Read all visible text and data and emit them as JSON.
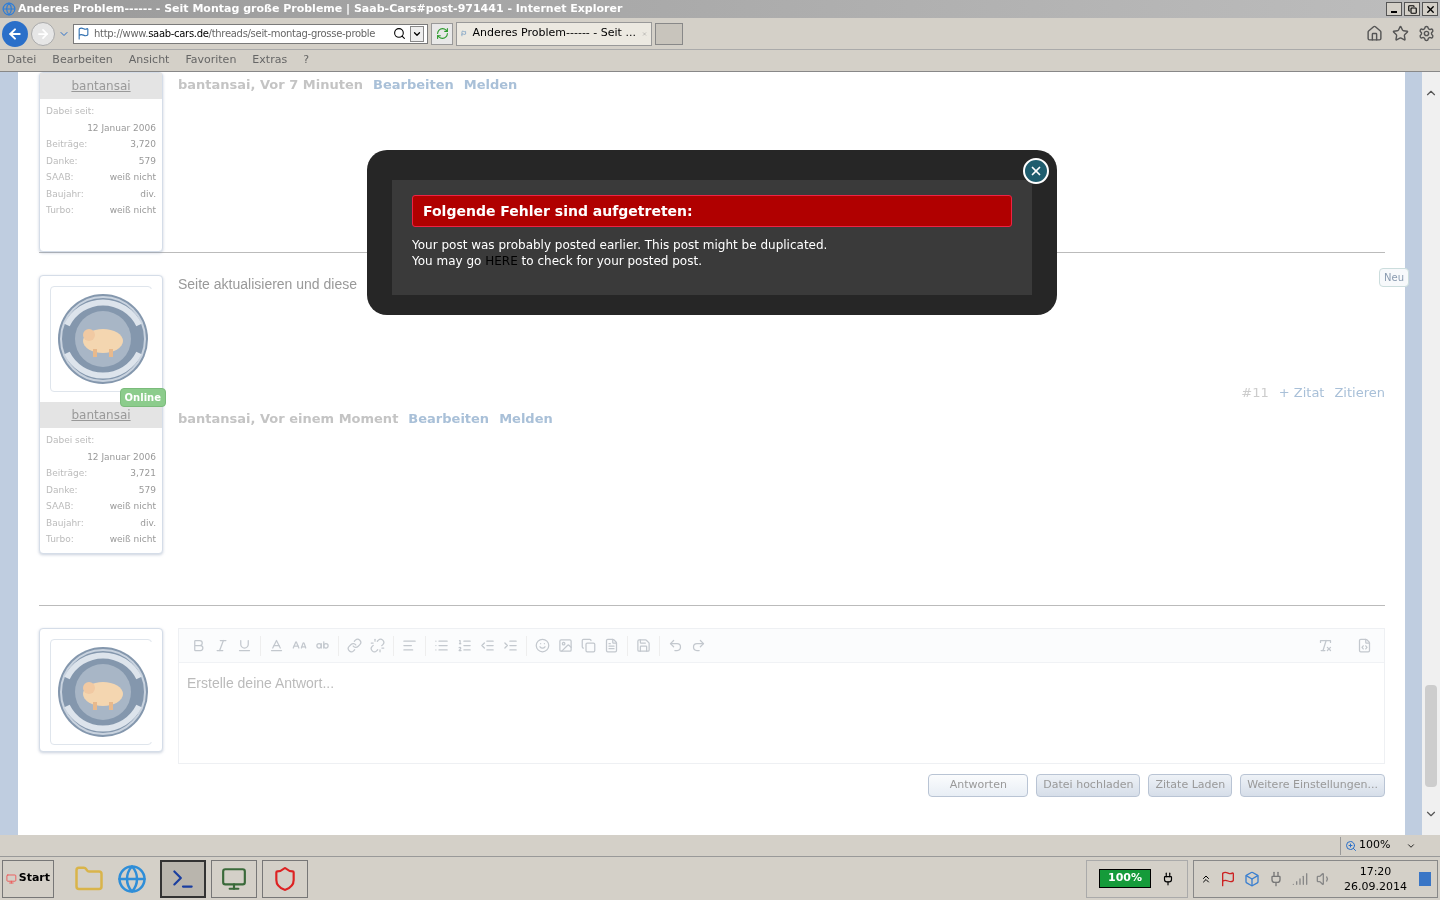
{
  "window": {
    "title": "Anderes Problem------ - Seit Montag große Probleme | Saab-Cars#post-971441 - Internet Explorer"
  },
  "address_bar": {
    "url_parts": [
      {
        "text": "http://www.",
        "kind": "dim"
      },
      {
        "text": "saab-cars.de",
        "kind": "domain"
      },
      {
        "text": "/threads/seit-montag-grosse-proble",
        "kind": "dim"
      }
    ]
  },
  "tabs": [
    {
      "title": "Anderes Problem------ - Seit ...",
      "selected": true
    }
  ],
  "menu": [
    "Datei",
    "Bearbeiten",
    "Ansicht",
    "Favoriten",
    "Extras",
    "?"
  ],
  "posts": [
    {
      "author": "bantansai",
      "joined": {
        "label": "Dabei seit:",
        "value": "12 Januar 2006"
      },
      "stats": [
        {
          "label": "Beiträge:",
          "value": "3,720"
        },
        {
          "label": "Danke:",
          "value": "579"
        },
        {
          "label": "SAAB:",
          "value": "weiß nicht"
        },
        {
          "label": "Baujahr:",
          "value": "div."
        },
        {
          "label": "Turbo:",
          "value": "weiß nicht"
        }
      ],
      "byline": "bantansai, Vor 7 Minuten",
      "actions": [
        "Bearbeiten",
        "Melden"
      ]
    },
    {
      "author": "bantansai",
      "avatar": {
        "kind": "picture"
      },
      "online": "Online",
      "joined": {
        "label": "Dabei seit:",
        "value": "12 Januar 2006"
      },
      "stats": [
        {
          "label": "Beiträge:",
          "value": "3,721"
        },
        {
          "label": "Danke:",
          "value": "579"
        },
        {
          "label": "SAAB:",
          "value": "weiß nicht"
        },
        {
          "label": "Baujahr:",
          "value": "div."
        },
        {
          "label": "Turbo:",
          "value": "weiß nicht"
        }
      ],
      "text": "Seite aktualisieren und diese",
      "badge": "Neu",
      "number": "#11",
      "quote_actions": [
        "+ Zitat",
        "Zitieren"
      ],
      "byline": "bantansai, Vor einem Moment",
      "actions": [
        "Bearbeiten",
        "Melden"
      ]
    }
  ],
  "reply": {
    "placeholder": "Erstelle deine Antwort...",
    "buttons": [
      "Antworten",
      "Datei hochladen",
      "Zitate Laden",
      "Weitere Einstellungen..."
    ]
  },
  "modal": {
    "heading": "Folgende Fehler sind aufgetreten:",
    "line_1": "Your post was probably posted earlier. This post might be duplicated.",
    "line_2_before": "You may go ",
    "link": "HERE",
    "line_2_after": " to check for your posted post."
  },
  "status_bar": {
    "zoom": "100%"
  },
  "taskbar": {
    "start": "Start",
    "battery": "100%",
    "time": "17:20",
    "date": "26.09.2014"
  }
}
